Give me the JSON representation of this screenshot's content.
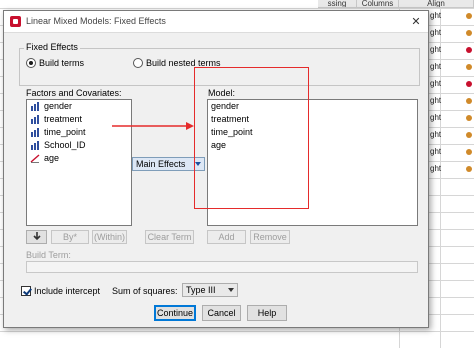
{
  "background": {
    "column_headers": [
      "ssing",
      "Columns",
      "Align"
    ],
    "align_values": [
      "ght",
      "ght",
      "ght",
      "ght",
      "ght",
      "ght",
      "ght",
      "ght",
      "ght",
      "ght"
    ]
  },
  "dialog": {
    "title": "Linear Mixed Models: Fixed Effects",
    "close_glyph": "✕",
    "fixed_effects_legend": "Fixed Effects",
    "build_terms_label": "Build terms",
    "build_nested_label": "Build nested terms",
    "factors_label": "Factors and Covariates:",
    "factors": [
      {
        "name": "gender",
        "icon": "nominal-icon"
      },
      {
        "name": "treatment",
        "icon": "nominal-icon"
      },
      {
        "name": "time_point",
        "icon": "nominal-icon"
      },
      {
        "name": "School_ID",
        "icon": "nominal-icon"
      },
      {
        "name": "age",
        "icon": "scale-icon"
      }
    ],
    "model_label": "Model:",
    "model_terms": [
      "gender",
      "treatment",
      "time_point",
      "age"
    ],
    "main_effects_label": "Main Effects",
    "arrow_button_glyph": "➜",
    "by_button": "By*",
    "within_button": "(Within)",
    "clear_term_button": "Clear Term",
    "add_button": "Add",
    "remove_button": "Remove",
    "build_term_label": "Build Term:",
    "include_intercept_label": "Include intercept",
    "sum_of_squares_label": "Sum of squares:",
    "sum_of_squares_value": "Type III",
    "continue_button": "Continue",
    "cancel_button": "Cancel",
    "help_button": "Help"
  },
  "colors": {
    "annotation": "#e52b2b",
    "default_button_border": "#0078d7"
  }
}
